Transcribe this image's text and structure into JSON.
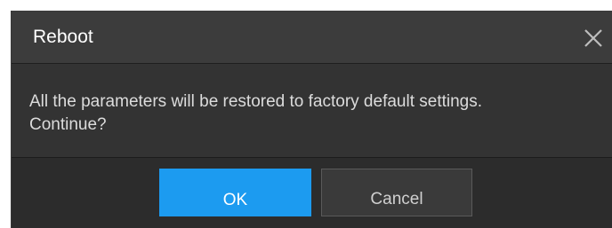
{
  "dialog": {
    "title": "Reboot",
    "close_icon": "close-icon",
    "message_line1": "All the parameters will be restored to factory default settings.",
    "message_line2": "Continue?",
    "ok_label": "OK",
    "cancel_label": "Cancel"
  },
  "colors": {
    "primary_button": "#1c9bf0",
    "dialog_background": "#2d2d2d",
    "titlebar_background": "#3c3c3c"
  }
}
